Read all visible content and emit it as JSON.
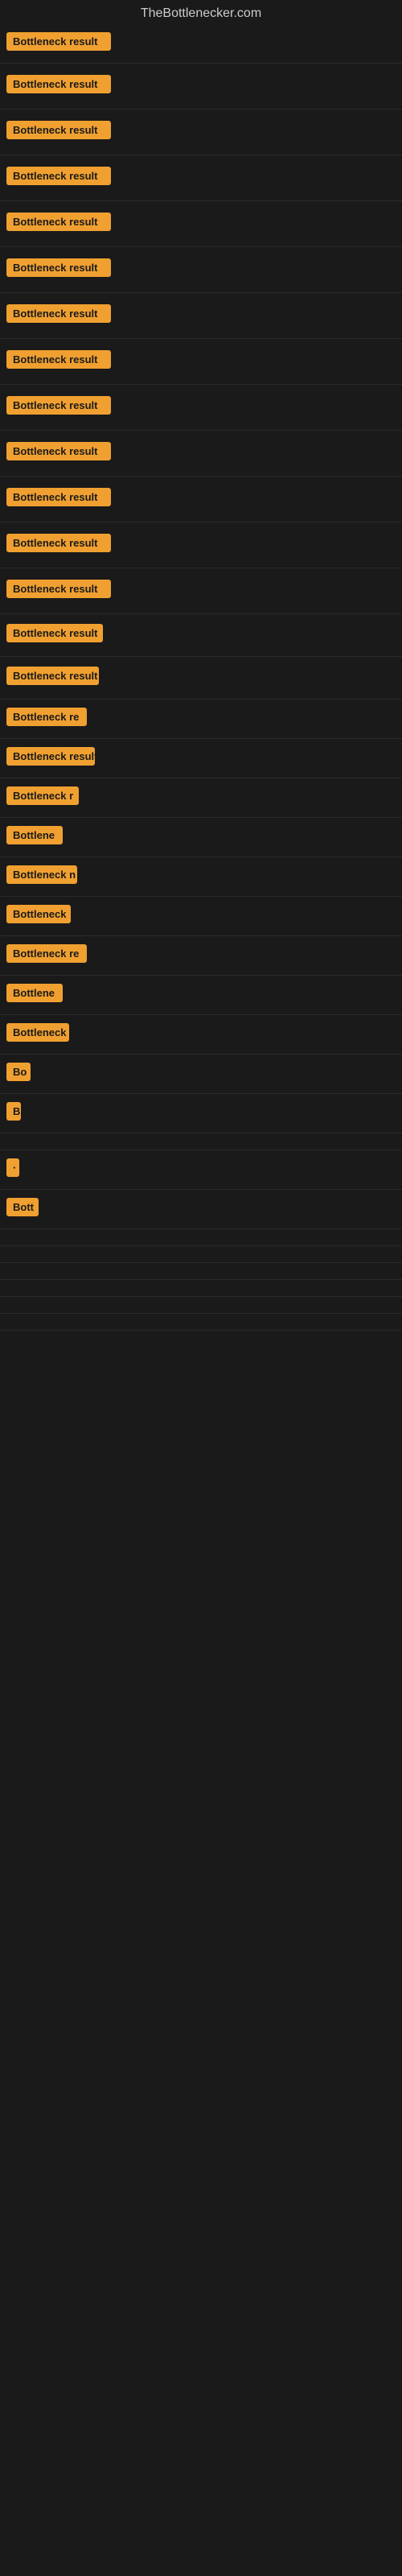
{
  "site": {
    "title": "TheBottlenecker.com"
  },
  "items": [
    {
      "id": 1,
      "label": "Bottleneck result",
      "truncated": false
    },
    {
      "id": 2,
      "label": "Bottleneck result",
      "truncated": false
    },
    {
      "id": 3,
      "label": "Bottleneck result",
      "truncated": false
    },
    {
      "id": 4,
      "label": "Bottleneck result",
      "truncated": false
    },
    {
      "id": 5,
      "label": "Bottleneck result",
      "truncated": false
    },
    {
      "id": 6,
      "label": "Bottleneck result",
      "truncated": false
    },
    {
      "id": 7,
      "label": "Bottleneck result",
      "truncated": false
    },
    {
      "id": 8,
      "label": "Bottleneck result",
      "truncated": false
    },
    {
      "id": 9,
      "label": "Bottleneck result",
      "truncated": false
    },
    {
      "id": 10,
      "label": "Bottleneck result",
      "truncated": false
    },
    {
      "id": 11,
      "label": "Bottleneck result",
      "truncated": false
    },
    {
      "id": 12,
      "label": "Bottleneck result",
      "truncated": false
    },
    {
      "id": 13,
      "label": "Bottleneck result",
      "truncated": false
    },
    {
      "id": 14,
      "label": "Bottleneck result",
      "truncated": false
    },
    {
      "id": 15,
      "label": "Bottleneck result",
      "truncated": false
    },
    {
      "id": 16,
      "label": "Bottleneck re",
      "truncated": true
    },
    {
      "id": 17,
      "label": "Bottleneck result",
      "truncated": false
    },
    {
      "id": 18,
      "label": "Bottleneck r",
      "truncated": true
    },
    {
      "id": 19,
      "label": "Bottlene",
      "truncated": true
    },
    {
      "id": 20,
      "label": "Bottleneck n",
      "truncated": true
    },
    {
      "id": 21,
      "label": "Bottleneck",
      "truncated": true
    },
    {
      "id": 22,
      "label": "Bottleneck re",
      "truncated": true
    },
    {
      "id": 23,
      "label": "Bottlene",
      "truncated": true
    },
    {
      "id": 24,
      "label": "Bottleneck",
      "truncated": true
    },
    {
      "id": 25,
      "label": "Bo",
      "truncated": true
    },
    {
      "id": 26,
      "label": "B",
      "truncated": true
    },
    {
      "id": 27,
      "label": "",
      "truncated": true
    },
    {
      "id": 28,
      "label": "·",
      "truncated": true
    },
    {
      "id": 29,
      "label": "Bott",
      "truncated": true
    },
    {
      "id": 30,
      "label": "",
      "truncated": true
    },
    {
      "id": 31,
      "label": "",
      "truncated": true
    },
    {
      "id": 32,
      "label": "",
      "truncated": true
    },
    {
      "id": 33,
      "label": "",
      "truncated": true
    },
    {
      "id": 34,
      "label": "",
      "truncated": true
    },
    {
      "id": 35,
      "label": "",
      "truncated": true
    }
  ]
}
